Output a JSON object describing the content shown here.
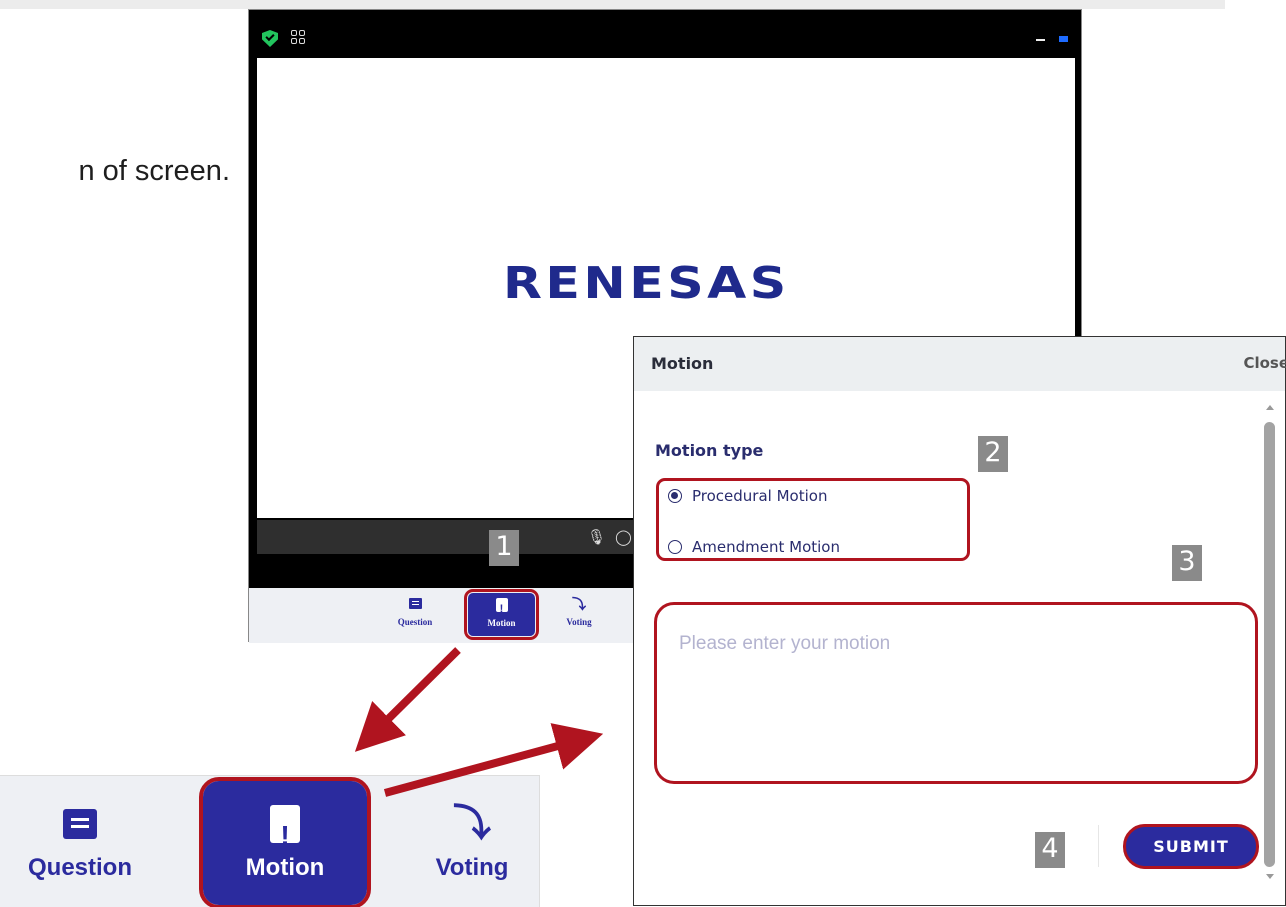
{
  "instruction": {
    "text": "n of screen."
  },
  "app": {
    "logo_text": "RENESAS",
    "nav": {
      "question_label": "Question",
      "motion_label": "Motion",
      "voting_label": "Voting"
    }
  },
  "callouts": {
    "one": "1",
    "two": "2",
    "three": "3",
    "four": "4"
  },
  "panel": {
    "title": "Motion",
    "close_label": "Close",
    "field_label": "Motion type",
    "options": [
      {
        "label": "Procedural Motion",
        "selected": true
      },
      {
        "label": "Amendment Motion",
        "selected": false
      }
    ],
    "textarea": {
      "placeholder": "Please enter your motion",
      "value": ""
    },
    "submit_label": "SUBMIT"
  },
  "zoom": {
    "question_label": "Question",
    "motion_label": "Motion",
    "voting_label": "Voting"
  },
  "colors": {
    "accent": "#2b2b9e",
    "highlight": "#b0141f",
    "brand": "#1f2a8c",
    "badge": "#8a8a8a"
  },
  "icons": [
    "shield-icon",
    "grid-icon",
    "minimize-icon",
    "maximize-icon",
    "mic-settings-icon",
    "chat-icon",
    "question-icon",
    "motion-icon",
    "voting-gavel-icon"
  ]
}
